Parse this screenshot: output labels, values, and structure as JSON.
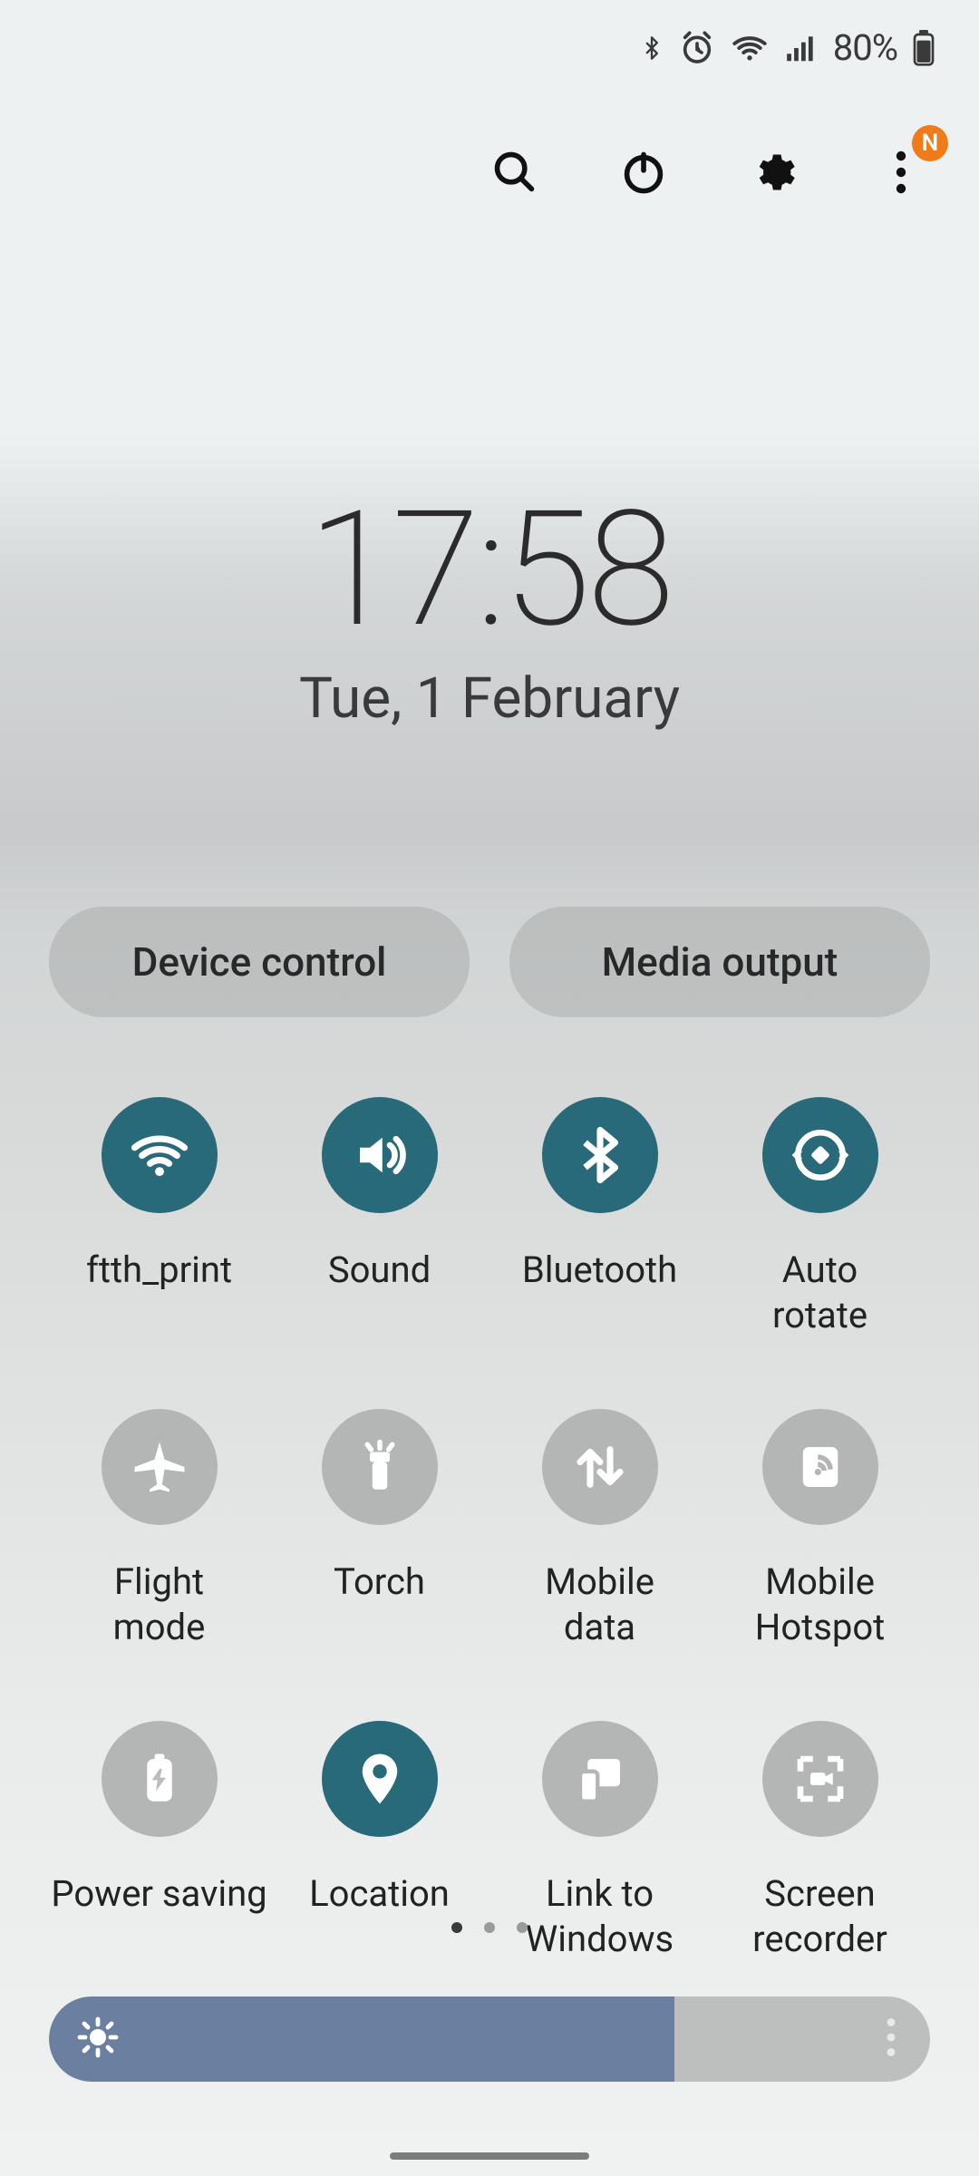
{
  "status": {
    "battery_text": "80%"
  },
  "badge": "N",
  "clock": {
    "time": "17:58",
    "date": "Tue, 1 February"
  },
  "pills": {
    "device": "Device control",
    "media": "Media output"
  },
  "toggles": [
    {
      "name": "wifi",
      "label": "ftth_print",
      "active": true,
      "icon": "wifi"
    },
    {
      "name": "sound",
      "label": "Sound",
      "active": true,
      "icon": "sound"
    },
    {
      "name": "bluetooth",
      "label": "Bluetooth",
      "active": true,
      "icon": "bluetooth"
    },
    {
      "name": "auto-rotate",
      "label": "Auto\nrotate",
      "active": true,
      "icon": "rotate"
    },
    {
      "name": "flight-mode",
      "label": "Flight\nmode",
      "active": false,
      "icon": "airplane"
    },
    {
      "name": "torch",
      "label": "Torch",
      "active": false,
      "icon": "torch"
    },
    {
      "name": "mobile-data",
      "label": "Mobile\ndata",
      "active": false,
      "icon": "data"
    },
    {
      "name": "mobile-hotspot",
      "label": "Mobile\nHotspot",
      "active": false,
      "icon": "hotspot"
    },
    {
      "name": "power-saving",
      "label": "Power saving",
      "active": false,
      "icon": "psave"
    },
    {
      "name": "location",
      "label": "Location",
      "active": true,
      "icon": "location"
    },
    {
      "name": "link-to-windows",
      "label": "Link to\nWindows",
      "active": false,
      "icon": "linkwin"
    },
    {
      "name": "screen-recorder",
      "label": "Screen\nrecorder",
      "active": false,
      "icon": "recorder"
    }
  ],
  "brightness": {
    "percent": 71
  },
  "pages": {
    "count": 3,
    "current": 0
  },
  "colors": {
    "active": "#296a7a",
    "inactive": "#b4b6b6",
    "slider_fill": "#6b7fa1",
    "badge": "#f07b1a"
  }
}
